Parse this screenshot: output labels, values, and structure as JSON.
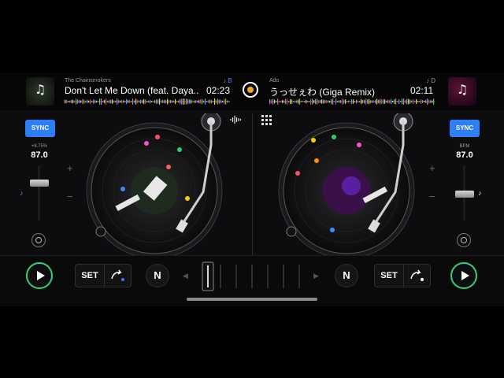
{
  "colors": {
    "accent_blue": "#2d7ff9",
    "play_green": "#33d17a",
    "center_orange": "#f5a623"
  },
  "deck_left": {
    "artist": "The Chainsmokers",
    "title": "Don't Let Me Down (feat. Daya...",
    "time": "02:23",
    "deck_label": "♪ B",
    "sync_label": "SYNC",
    "pitch_label": "+8.75%",
    "bpm": "87.0",
    "plus": "+",
    "minus": "−",
    "set_label": "SET",
    "n_label": "N",
    "play_icon": "play-icon"
  },
  "deck_right": {
    "artist": "Ado",
    "title": "うっせぇわ (Giga Remix)",
    "time": "02:11",
    "deck_label": "♪ D",
    "sync_label": "SYNC",
    "pitch_label": "BPM",
    "bpm": "87.0",
    "plus": "+",
    "minus": "−",
    "set_label": "SET",
    "n_label": "N",
    "play_icon": "play-icon"
  },
  "icons": {
    "art_note": "♫",
    "waveform": "waveform-icon",
    "grid": "grid-icon"
  }
}
